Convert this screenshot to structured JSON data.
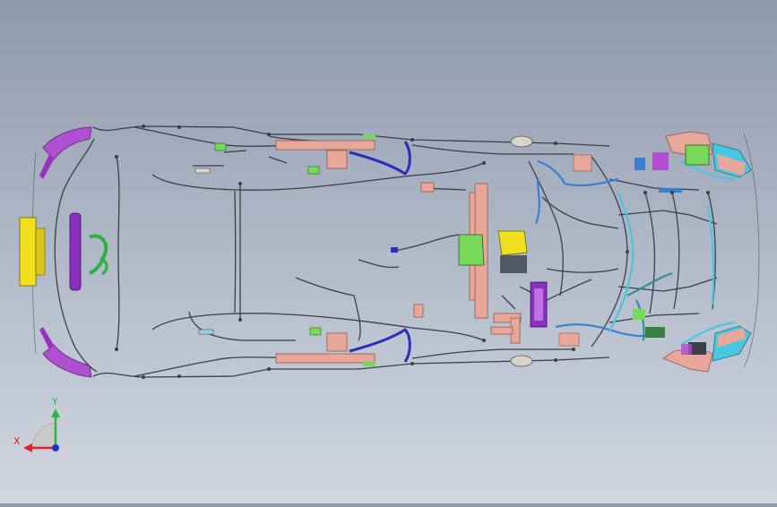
{
  "triad": {
    "x_label": "X",
    "y_label": "Y",
    "x_color": "#e0202a",
    "y_color": "#2bb34a",
    "z_color": "#2030d0"
  },
  "palette": {
    "wire": "#3a3f4a",
    "trunk": "#e9a79a",
    "trunk_edge": "#8c5a52",
    "magenta": "#b04fd0",
    "yellow": "#f0e020",
    "green": "#78d85a",
    "navy": "#2a2fb8",
    "cyan": "#47c7e0",
    "teal": "#2f8f9a",
    "blue": "#3b7fd0"
  }
}
